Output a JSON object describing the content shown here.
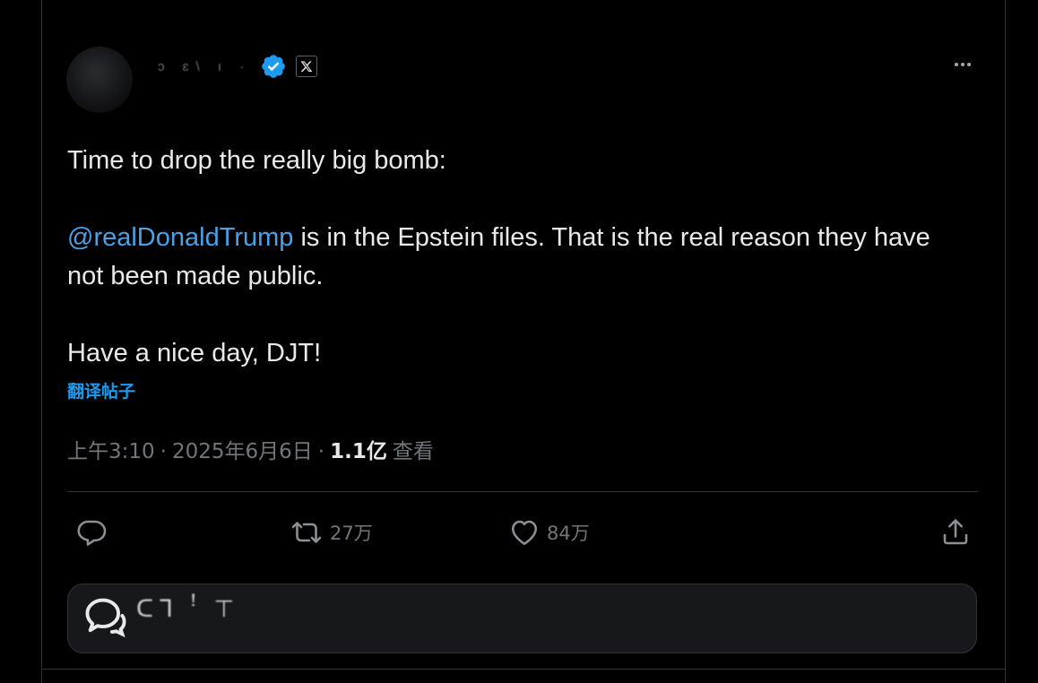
{
  "author": {
    "display_name": "ᴐ ɛ\\ ı ·",
    "verified_icon": "verified-badge-icon",
    "affiliation_icon": "x-logo-icon"
  },
  "more_icon": "more-horizontal-icon",
  "tweet": {
    "line1": "Time to drop the really big bomb:",
    "mention": "@realDonaldTrump",
    "line2_rest": " is in the Epstein files. That is the real reason they have not been made public.",
    "line3": "Have a nice day, DJT!"
  },
  "translate_label": "翻译帖子",
  "meta": {
    "time": "上午3:10",
    "separator1": "·",
    "date": "2025年6月6日",
    "separator2": "·",
    "views_count": "1.1亿",
    "views_label": "查看"
  },
  "actions": {
    "reply_icon": "reply-icon",
    "retweet_icon": "retweet-icon",
    "retweet_count": "27万",
    "like_icon": "heart-icon",
    "like_count": "84万",
    "share_icon": "share-icon"
  },
  "reply_box": {
    "icon": "chat-bubble-icon",
    "placeholder": "ᑕᒣ ꜝ ⊤"
  },
  "colors": {
    "background": "#000000",
    "text": "#e7e9ea",
    "muted": "#71767b",
    "accent": "#1d9bf0",
    "border": "#2f3336"
  }
}
